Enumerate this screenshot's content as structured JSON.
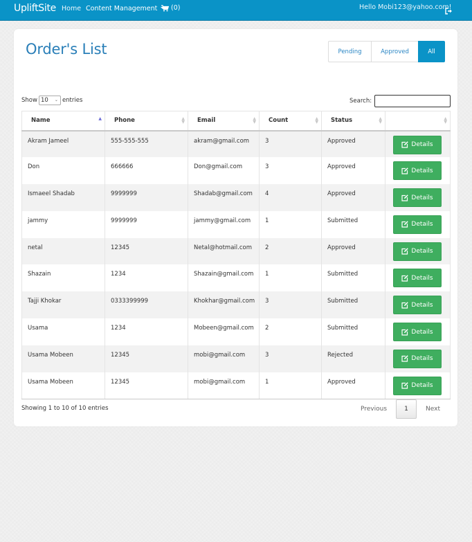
{
  "nav": {
    "brand": "UpliftSite",
    "home": "Home",
    "content_management": "Content Management",
    "cart_count": "(0)",
    "greeting": "Hello Mobi123@yahoo.com!"
  },
  "page": {
    "title": "Order's List",
    "filters": [
      "Pending",
      "Approved",
      "All"
    ],
    "active_filter": "All"
  },
  "controls": {
    "show_label": "Show",
    "entries_value": "10",
    "entries_label": "entries",
    "search_label": "Search:",
    "search_value": ""
  },
  "table": {
    "columns": [
      "Name",
      "Phone",
      "Email",
      "Count",
      "Status",
      ""
    ],
    "sorted_column": "Name",
    "action_label": "Details",
    "rows": [
      {
        "name": "Akram Jameel",
        "phone": "555-555-555",
        "email": "akram@gmail.com",
        "count": "3",
        "status": "Approved"
      },
      {
        "name": "Don",
        "phone": "666666",
        "email": "Don@gmail.com",
        "count": "3",
        "status": "Approved"
      },
      {
        "name": "Ismaeel Shadab",
        "phone": "9999999",
        "email": "Shadab@gmail.com",
        "count": "4",
        "status": "Approved"
      },
      {
        "name": "jammy",
        "phone": "9999999",
        "email": "jammy@gmail.com",
        "count": "1",
        "status": "Submitted"
      },
      {
        "name": "netal",
        "phone": "12345",
        "email": "Netal@hotmail.com",
        "count": "2",
        "status": "Approved"
      },
      {
        "name": "Shazain",
        "phone": "1234",
        "email": "Shazain@gmail.com",
        "count": "1",
        "status": "Submitted"
      },
      {
        "name": "Tajji Khokar",
        "phone": "0333399999",
        "email": "Khokhar@gmail.com",
        "count": "3",
        "status": "Submitted"
      },
      {
        "name": "Usama",
        "phone": "1234",
        "email": "Mobeen@gmail.com",
        "count": "2",
        "status": "Submitted"
      },
      {
        "name": "Usama Mobeen",
        "phone": "12345",
        "email": "mobi@gmail.com",
        "count": "3",
        "status": "Rejected"
      },
      {
        "name": "Usama Mobeen",
        "phone": "12345",
        "email": "mobi@gmail.com",
        "count": "1",
        "status": "Approved"
      }
    ]
  },
  "footer": {
    "info": "Showing 1 to 10 of 10 entries",
    "previous": "Previous",
    "page": "1",
    "next": "Next"
  },
  "colors": {
    "navbar": "#0a93c7",
    "title": "#2a7fb8",
    "details_button": "#3fae5f"
  },
  "icons": {
    "cart": "cart-icon",
    "logout": "logout-icon",
    "details": "edit-icon"
  }
}
